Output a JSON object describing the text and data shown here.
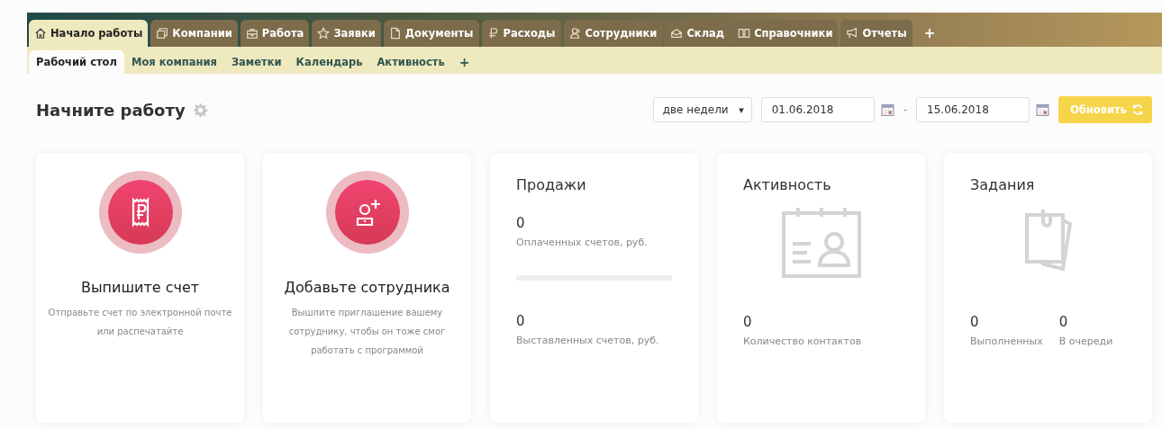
{
  "tabs": [
    {
      "label": "Начало работы",
      "selected": true
    },
    {
      "label": "Компании",
      "selected": false
    },
    {
      "label": "Работа",
      "selected": false
    },
    {
      "label": "Заявки",
      "selected": false
    },
    {
      "label": "Документы",
      "selected": false
    },
    {
      "label": "Расходы",
      "selected": false
    },
    {
      "label": "Сотрудники",
      "selected": false
    },
    {
      "label": "Склад",
      "selected": false
    },
    {
      "label": "Справочники",
      "selected": false
    },
    {
      "label": "Отчеты",
      "selected": false
    }
  ],
  "tab_add": "+",
  "subtabs": [
    {
      "label": "Рабочий стол",
      "selected": true
    },
    {
      "label": "Моя компания",
      "selected": false
    },
    {
      "label": "Заметки",
      "selected": false
    },
    {
      "label": "Календарь",
      "selected": false
    },
    {
      "label": "Активность",
      "selected": false
    }
  ],
  "subtab_add": "+",
  "page_title": "Начните работу",
  "period": {
    "value": "две недели",
    "arrow": "▾"
  },
  "date_from": "01.06.2018",
  "date_separator": "-",
  "date_to": "15.06.2018",
  "refresh_button": "Обновить",
  "cards": [
    {
      "kind": "invoice",
      "title": "Выпишите счет",
      "description": "Отправьте счет по электронной почте или распечатайте"
    },
    {
      "kind": "employee",
      "title": "Добавьте сотрудника",
      "description": "Вышлите приглашение вашему сотруднику, чтобы он тоже смог работать с программой"
    },
    {
      "kind": "sales",
      "title": "Продажи",
      "stats": [
        {
          "value": "0",
          "label": "Оплаченных счетов, руб."
        },
        {
          "value": "0",
          "label": "Выставленных счетов, руб."
        }
      ]
    },
    {
      "kind": "activity",
      "title": "Активность",
      "stats": [
        {
          "value": "0",
          "label": "Количество контактов"
        }
      ]
    },
    {
      "kind": "tasks",
      "title": "Задания",
      "stats": [
        {
          "value": "0",
          "label": "Выполненных"
        },
        {
          "value": "0",
          "label": "В очереди"
        }
      ]
    }
  ]
}
